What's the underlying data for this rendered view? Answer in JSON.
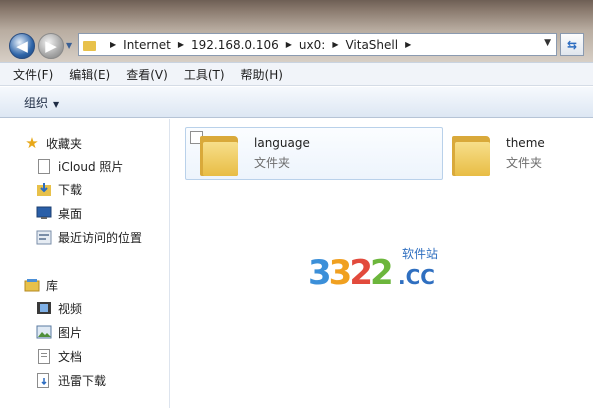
{
  "address": {
    "crumbs": [
      "Internet",
      "192.168.0.106",
      "ux0:",
      "VitaShell"
    ]
  },
  "menu": [
    "文件(F)",
    "编辑(E)",
    "查看(V)",
    "工具(T)",
    "帮助(H)"
  ],
  "toolbar": {
    "organize_label": "组织"
  },
  "nav": {
    "favorites_header": "收藏夹",
    "favorites": [
      "iCloud 照片",
      "下载",
      "桌面",
      "最近访问的位置"
    ],
    "libraries_header": "库",
    "libraries": [
      "视频",
      "图片",
      "文档",
      "迅雷下载"
    ]
  },
  "files": [
    {
      "name": "language",
      "type": "文件夹"
    },
    {
      "name": "theme",
      "type": "文件夹"
    }
  ],
  "watermark": {
    "digits": [
      "3",
      "3",
      "2",
      "2"
    ],
    "suffix": ".CC",
    "cn": "软件站"
  },
  "colors": {
    "accent": "#2f65a8",
    "folder": "#e8bd45",
    "selection": "#edf4fc"
  }
}
